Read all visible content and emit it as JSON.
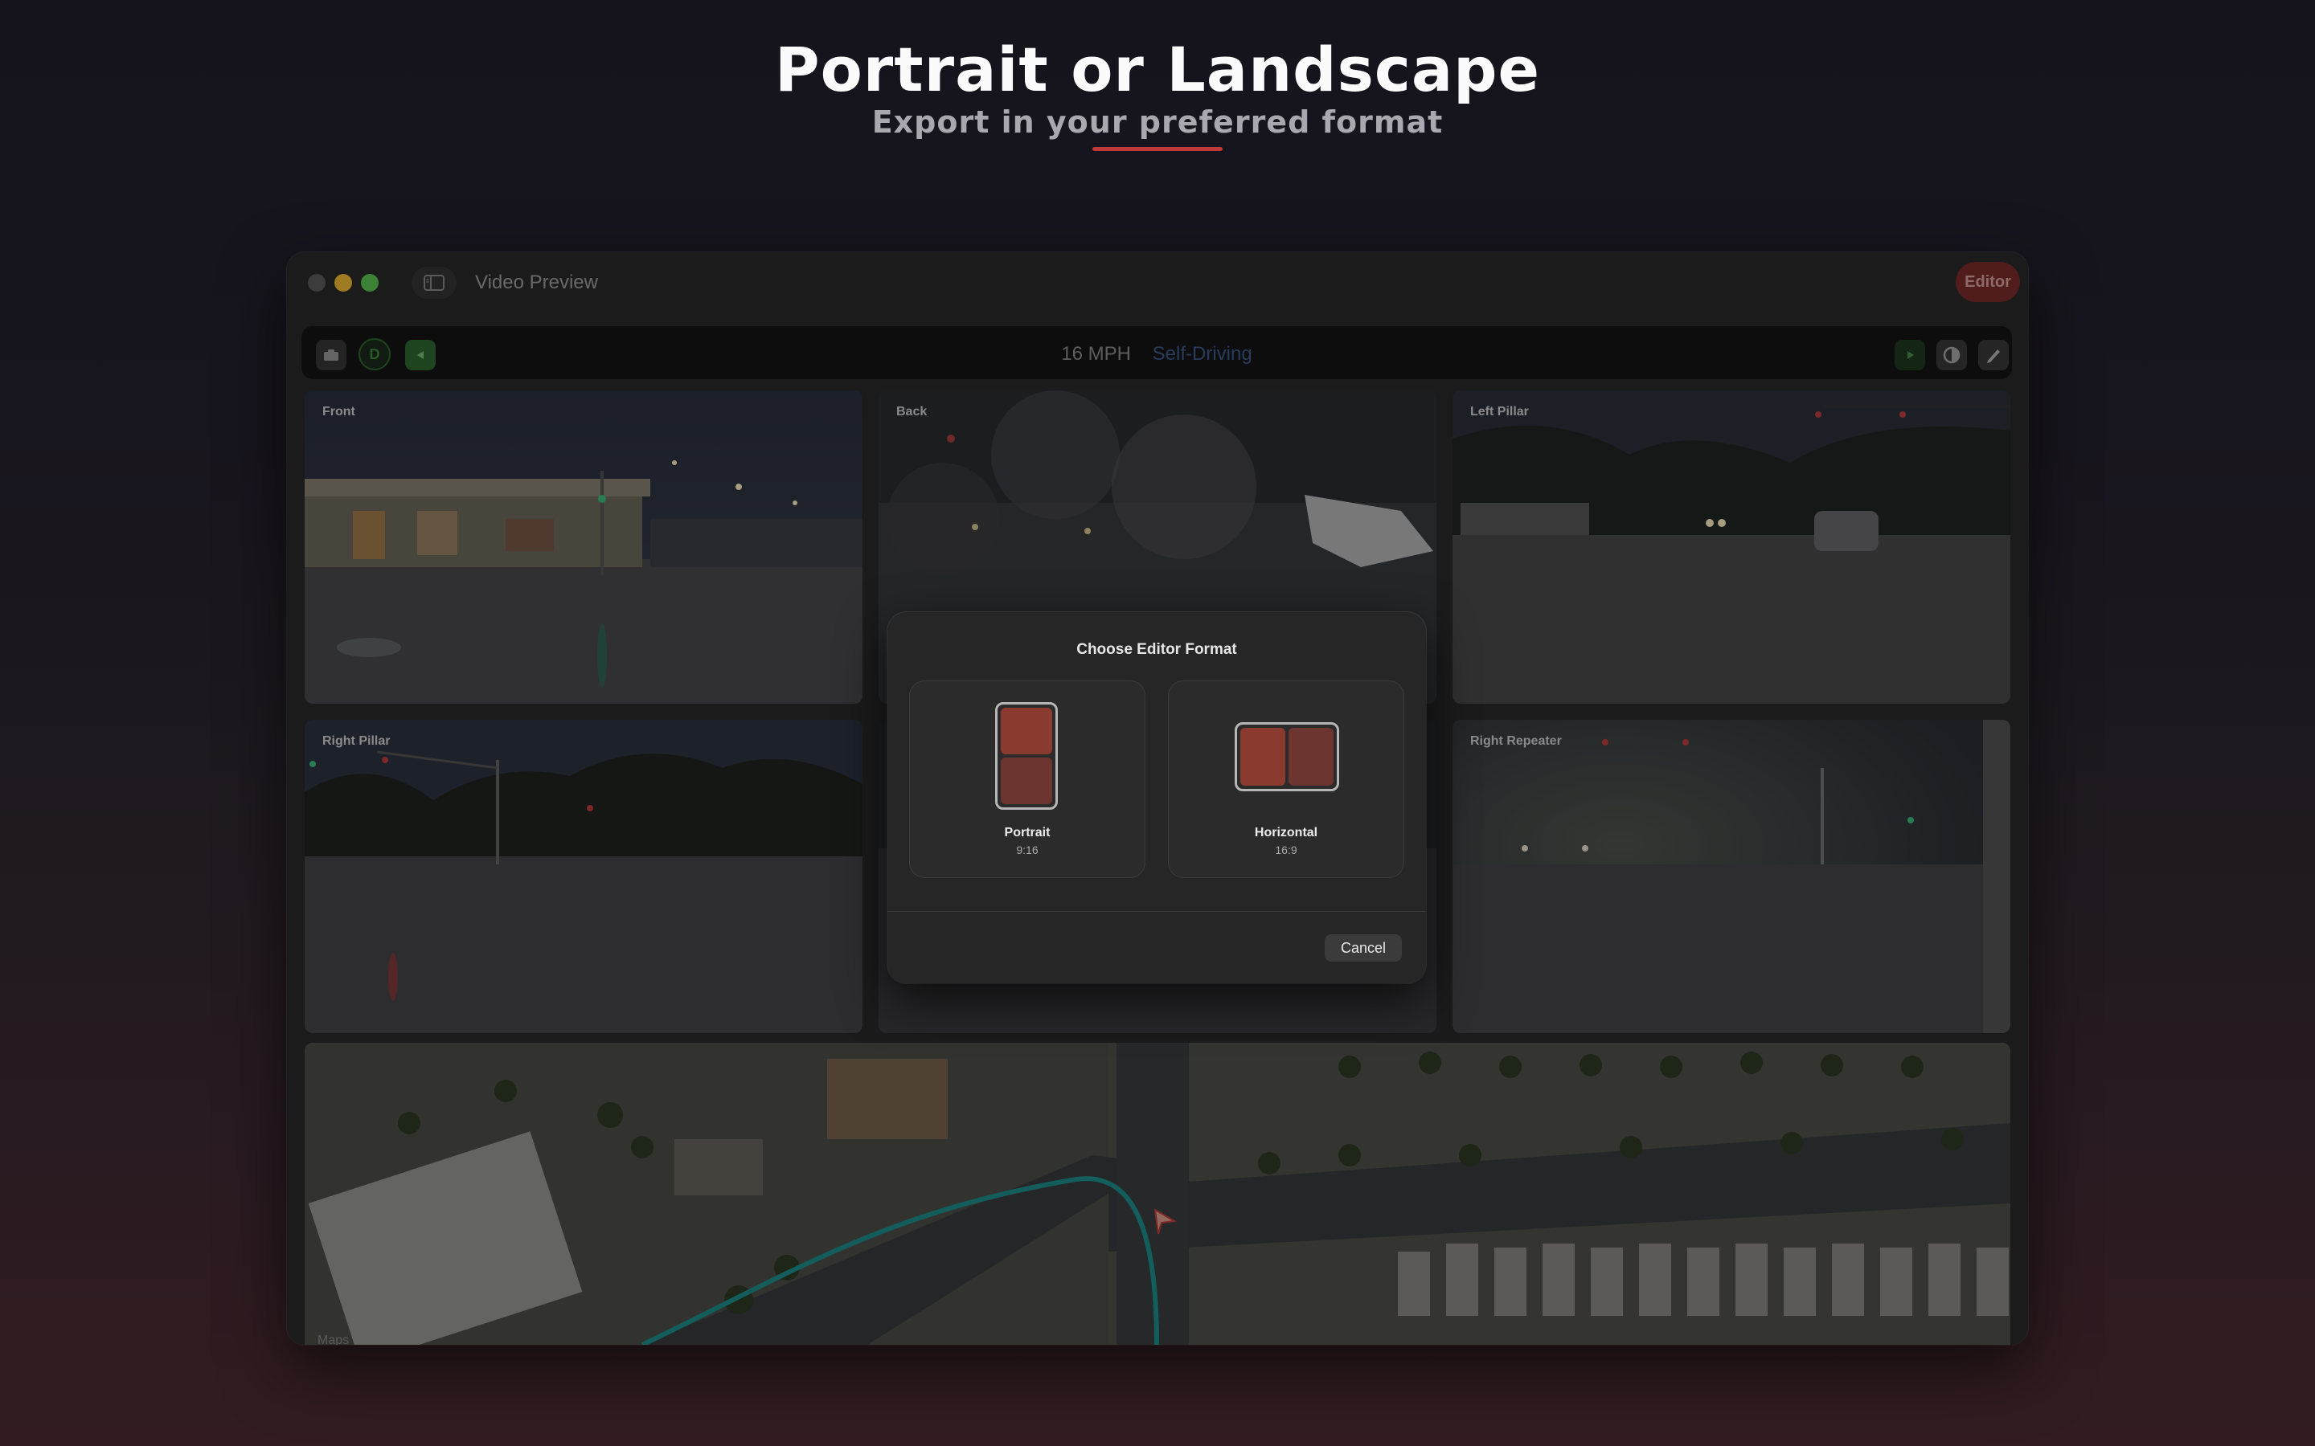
{
  "hero": {
    "title": "Portrait or Landscape",
    "subtitle": "Export in your preferred format"
  },
  "window": {
    "title": "Video Preview",
    "editor_label": "Editor"
  },
  "toolbar": {
    "gear_label": "D",
    "speed": "16 MPH",
    "mode": "Self-Driving"
  },
  "cameras": [
    {
      "label": "Front"
    },
    {
      "label": "Back"
    },
    {
      "label": "Left Pillar"
    },
    {
      "label": "Right Pillar"
    },
    {
      "label": "Right Repeater"
    }
  ],
  "map": {
    "label": "Maps"
  },
  "dialog": {
    "title": "Choose Editor Format",
    "options": [
      {
        "name": "Portrait",
        "ratio": "9:16"
      },
      {
        "name": "Horizontal",
        "ratio": "16:9"
      }
    ],
    "cancel": "Cancel"
  },
  "colors": {
    "accent_red": "#c0383a",
    "editor_bg": "#7b2c2b",
    "self_driving_blue": "#3e5f8f",
    "preview_tile_a": "#8b3a30",
    "preview_tile_b": "#6d352f"
  }
}
